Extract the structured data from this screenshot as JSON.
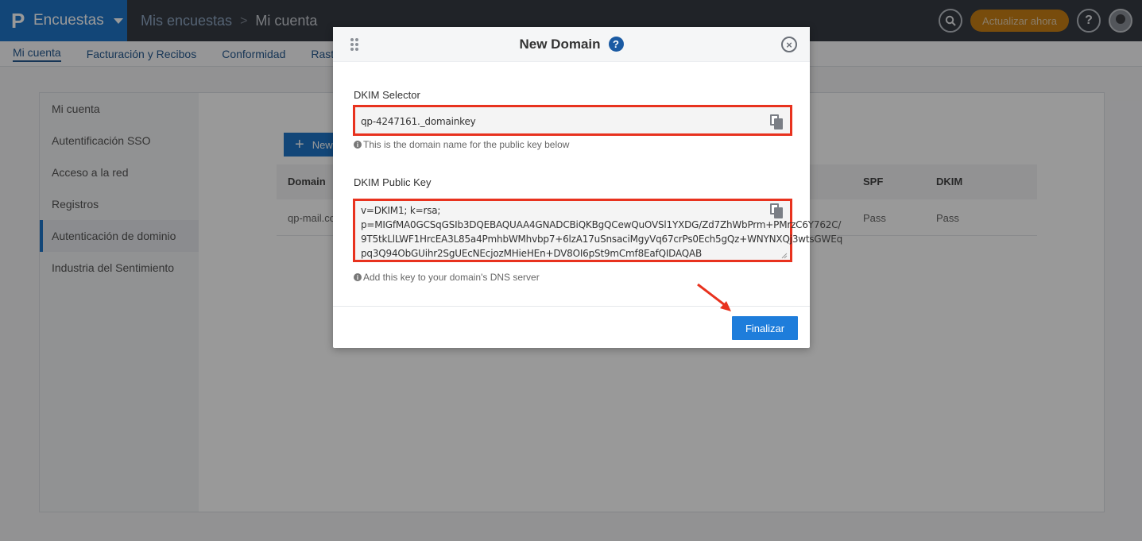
{
  "topbar": {
    "app_name": "Encuestas",
    "breadcrumb_parent": "Mis encuestas",
    "breadcrumb_separator": ">",
    "breadcrumb_current": "Mi cuenta",
    "upgrade_label": "Actualizar ahora",
    "help_glyph": "?"
  },
  "subnav": {
    "items": [
      "Mi cuenta",
      "Facturación y Recibos",
      "Conformidad",
      "Rast"
    ]
  },
  "sidebar": {
    "items": [
      "Mi cuenta",
      "Autentificación SSO",
      "Acceso a la red",
      "Registros",
      "Autenticación de dominio",
      "Industria del Sentimiento"
    ],
    "active_index": 4
  },
  "main": {
    "new_button_label": "New",
    "columns": {
      "domain": "Domain",
      "spf": "SPF",
      "dkim": "DKIM"
    },
    "rows": [
      {
        "domain": "qp-mail.co",
        "spf": "Pass",
        "dkim": "Pass"
      }
    ]
  },
  "modal": {
    "title": "New Domain",
    "help_glyph": "?",
    "close_glyph": "×",
    "selector_label": "DKIM Selector",
    "selector_value": "qp-4247161._domainkey",
    "selector_hint": "This is the domain name for the public key below",
    "pubkey_label": "DKIM Public Key",
    "pubkey_lines": [
      "v=DKIM1; k=rsa;",
      "p=MIGfMA0GCSqGSIb3DQEBAQUAA4GNADCBiQKBgQCewQuOVSl1YXDG/Zd7ZhWbPrm+PMrzC6Y762C/",
      "9T5tkLlLWF1HrcEA3L85a4PmhbWMhvbp7+6lzA17uSnsaciMgyVq67crPs0Ech5gQz+WNYNXQj3wtsGWEq",
      "pq3Q94ObGUihr2SgUEcNEcjozMHieHEn+DV8OI6pSt9mCmf8EafQIDAQAB"
    ],
    "pubkey_hint": "Add this key to your domain's DNS server",
    "finish_label": "Finalizar",
    "info_glyph": "i"
  },
  "colors": {
    "brand_blue": "#1e76c9",
    "highlight_red": "#e8321e",
    "upgrade_orange": "#d9870f"
  }
}
